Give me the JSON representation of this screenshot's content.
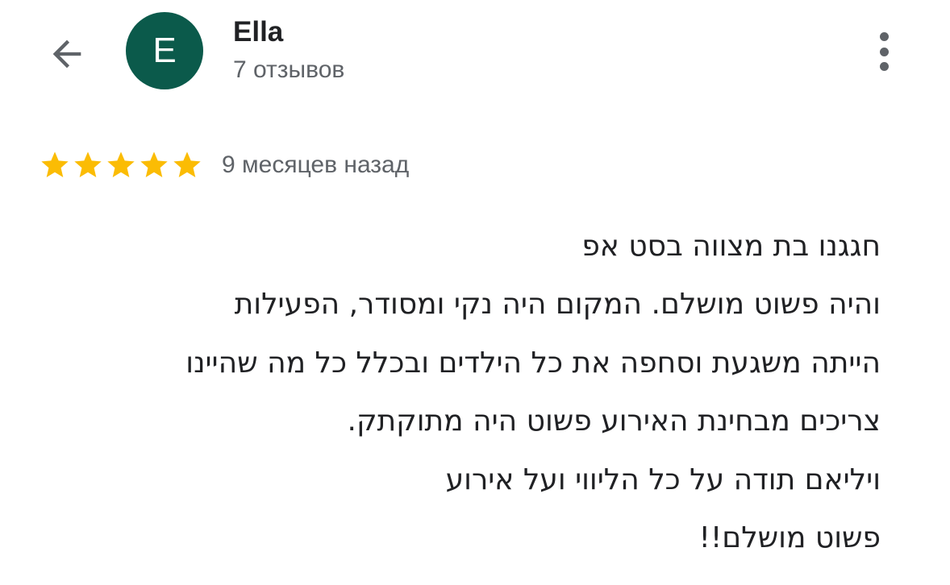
{
  "header": {
    "back_icon": "arrow-left-icon",
    "avatar_letter": "E",
    "avatar_color": "#0b5a4b",
    "user_name": "Ella",
    "review_count": "7 отзывов",
    "more_icon": "more-vertical-icon"
  },
  "review": {
    "rating": 5,
    "rating_max": 5,
    "star_color": "#fbbc04",
    "date": "9 месяцев назад",
    "lines": [
      "חגגנו בת מצווה בסט אפ",
      "והיה פשוט מושלם. המקום היה נקי ומסודר, הפעילות",
      "הייתה משגעת וסחפה את כל הילדים ובכלל כל מה שהיינו",
      "צריכים מבחינת האירוע פשוט היה מתוקתק.",
      "ויליאם תודה על כל הליווי ועל אירוע",
      "פשוט מושלם!!"
    ]
  }
}
